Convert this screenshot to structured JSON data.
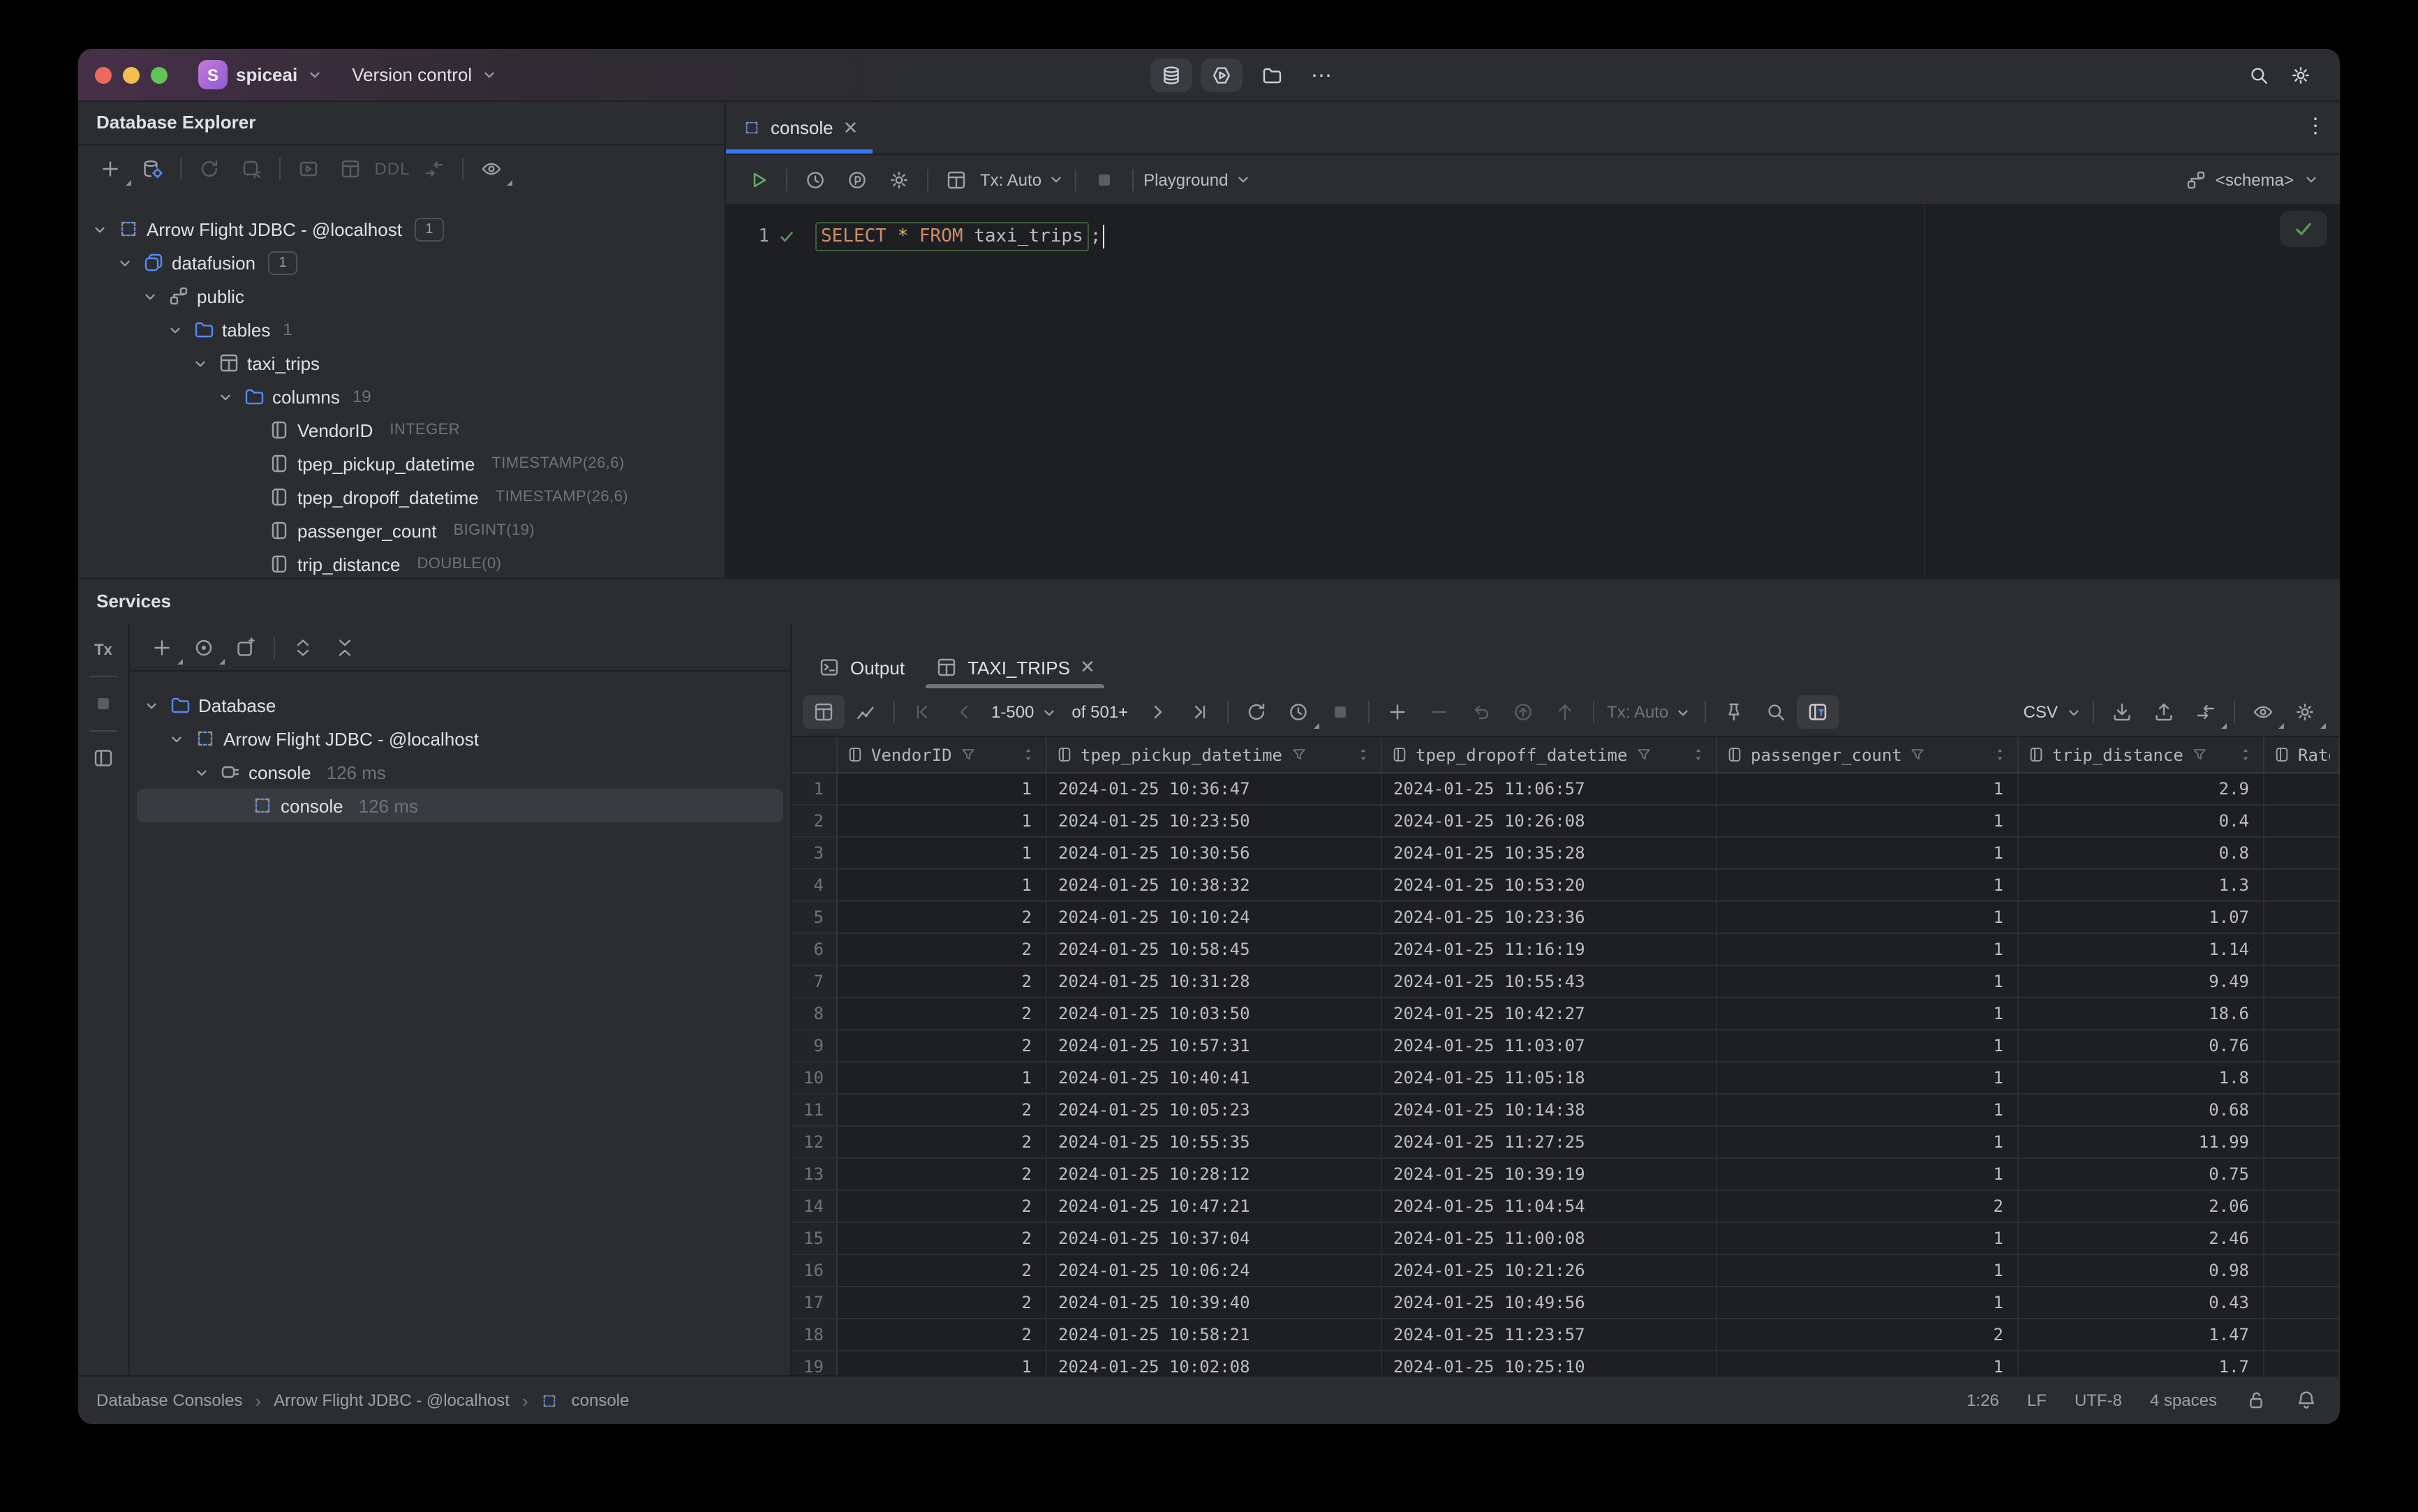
{
  "colors": {
    "accent_blue": "#3574F0",
    "icon_blue": "#548AF7",
    "green_ok": "#57965C",
    "keyword_orange": "#CF8E6D",
    "star_yellow": "#D5B778",
    "traffic_red": "#EC6A5E",
    "traffic_yellow": "#F4BF4F",
    "traffic_green": "#61C554",
    "selection_gray": "#393B40"
  },
  "titlebar": {
    "project_initial": "S",
    "project": "spiceai",
    "menu_vcs": "Version control"
  },
  "database_explorer": {
    "title": "Database Explorer",
    "toolbar_ddl": "DDL",
    "tree": [
      {
        "level": 0,
        "chevron": true,
        "icon": "api",
        "connected": true,
        "label": "Arrow Flight JDBC - @localhost",
        "badge": "1"
      },
      {
        "level": 1,
        "chevron": true,
        "icon": "db",
        "label": "datafusion",
        "badge": "1"
      },
      {
        "level": 2,
        "chevron": true,
        "icon": "schema",
        "label": "public"
      },
      {
        "level": 3,
        "chevron": true,
        "icon": "folder",
        "label": "tables",
        "count": "1"
      },
      {
        "level": 4,
        "chevron": true,
        "icon": "table",
        "label": "taxi_trips"
      },
      {
        "level": 5,
        "chevron": true,
        "icon": "folder",
        "label": "columns",
        "count": "19"
      },
      {
        "level": 6,
        "chevron": false,
        "icon": "column",
        "label": "VendorID",
        "type": "INTEGER"
      },
      {
        "level": 6,
        "chevron": false,
        "icon": "column",
        "label": "tpep_pickup_datetime",
        "type": "TIMESTAMP(26,6)"
      },
      {
        "level": 6,
        "chevron": false,
        "icon": "column",
        "label": "tpep_dropoff_datetime",
        "type": "TIMESTAMP(26,6)"
      },
      {
        "level": 6,
        "chevron": false,
        "icon": "column",
        "label": "passenger_count",
        "type": "BIGINT(19)"
      },
      {
        "level": 6,
        "chevron": false,
        "icon": "column",
        "label": "trip_distance",
        "type": "DOUBLE(0)"
      }
    ]
  },
  "editor": {
    "tab_label": "console",
    "tx_label": "Tx: Auto",
    "playground_label": "Playground",
    "schema_label": "<schema>",
    "line_number": "1",
    "sql_select": "SELECT",
    "sql_star": "*",
    "sql_from": "FROM",
    "sql_table": "taxi_trips",
    "sql_semicolon": ";"
  },
  "services": {
    "title": "Services",
    "strip_tx": "Tx",
    "tree": [
      {
        "level": 0,
        "chevron": true,
        "icon": "folder",
        "label": "Database"
      },
      {
        "level": 1,
        "chevron": true,
        "icon": "api",
        "label": "Arrow Flight JDBC - @localhost"
      },
      {
        "level": 2,
        "chevron": true,
        "icon": "plug",
        "connected": true,
        "label": "console",
        "time": "126 ms"
      },
      {
        "level": 3,
        "chevron": false,
        "icon": "api",
        "label": "console",
        "time": "126 ms",
        "selected": true
      }
    ]
  },
  "results": {
    "tab_output": "Output",
    "tab_table": "TAXI_TRIPS",
    "page_range": "1-500",
    "page_of": "of 501+",
    "tx_label": "Tx: Auto",
    "format_label": "CSV",
    "columns": [
      "VendorID",
      "tpep_pickup_datetime",
      "tpep_dropoff_datetime",
      "passenger_count",
      "trip_distance",
      "Rate"
    ],
    "rows": [
      [
        "1",
        "2024-01-25 10:36:47",
        "2024-01-25 11:06:57",
        "1",
        "2.9"
      ],
      [
        "1",
        "2024-01-25 10:23:50",
        "2024-01-25 10:26:08",
        "1",
        "0.4"
      ],
      [
        "1",
        "2024-01-25 10:30:56",
        "2024-01-25 10:35:28",
        "1",
        "0.8"
      ],
      [
        "1",
        "2024-01-25 10:38:32",
        "2024-01-25 10:53:20",
        "1",
        "1.3"
      ],
      [
        "2",
        "2024-01-25 10:10:24",
        "2024-01-25 10:23:36",
        "1",
        "1.07"
      ],
      [
        "2",
        "2024-01-25 10:58:45",
        "2024-01-25 11:16:19",
        "1",
        "1.14"
      ],
      [
        "2",
        "2024-01-25 10:31:28",
        "2024-01-25 10:55:43",
        "1",
        "9.49"
      ],
      [
        "2",
        "2024-01-25 10:03:50",
        "2024-01-25 10:42:27",
        "1",
        "18.6"
      ],
      [
        "2",
        "2024-01-25 10:57:31",
        "2024-01-25 11:03:07",
        "1",
        "0.76"
      ],
      [
        "1",
        "2024-01-25 10:40:41",
        "2024-01-25 11:05:18",
        "1",
        "1.8"
      ],
      [
        "2",
        "2024-01-25 10:05:23",
        "2024-01-25 10:14:38",
        "1",
        "0.68"
      ],
      [
        "2",
        "2024-01-25 10:55:35",
        "2024-01-25 11:27:25",
        "1",
        "11.99"
      ],
      [
        "2",
        "2024-01-25 10:28:12",
        "2024-01-25 10:39:19",
        "1",
        "0.75"
      ],
      [
        "2",
        "2024-01-25 10:47:21",
        "2024-01-25 11:04:54",
        "2",
        "2.06"
      ],
      [
        "2",
        "2024-01-25 10:37:04",
        "2024-01-25 11:00:08",
        "1",
        "2.46"
      ],
      [
        "2",
        "2024-01-25 10:06:24",
        "2024-01-25 10:21:26",
        "1",
        "0.98"
      ],
      [
        "2",
        "2024-01-25 10:39:40",
        "2024-01-25 10:49:56",
        "1",
        "0.43"
      ],
      [
        "2",
        "2024-01-25 10:58:21",
        "2024-01-25 11:23:57",
        "2",
        "1.47"
      ],
      [
        "1",
        "2024-01-25 10:02:08",
        "2024-01-25 10:25:10",
        "1",
        "1.7"
      ]
    ]
  },
  "statusbar": {
    "breadcrumb_root": "Database Consoles",
    "breadcrumb_conn": "Arrow Flight JDBC - @localhost",
    "breadcrumb_leaf": "console",
    "caret_position": "1:26",
    "line_separator": "LF",
    "encoding": "UTF-8",
    "indent": "4 spaces"
  }
}
